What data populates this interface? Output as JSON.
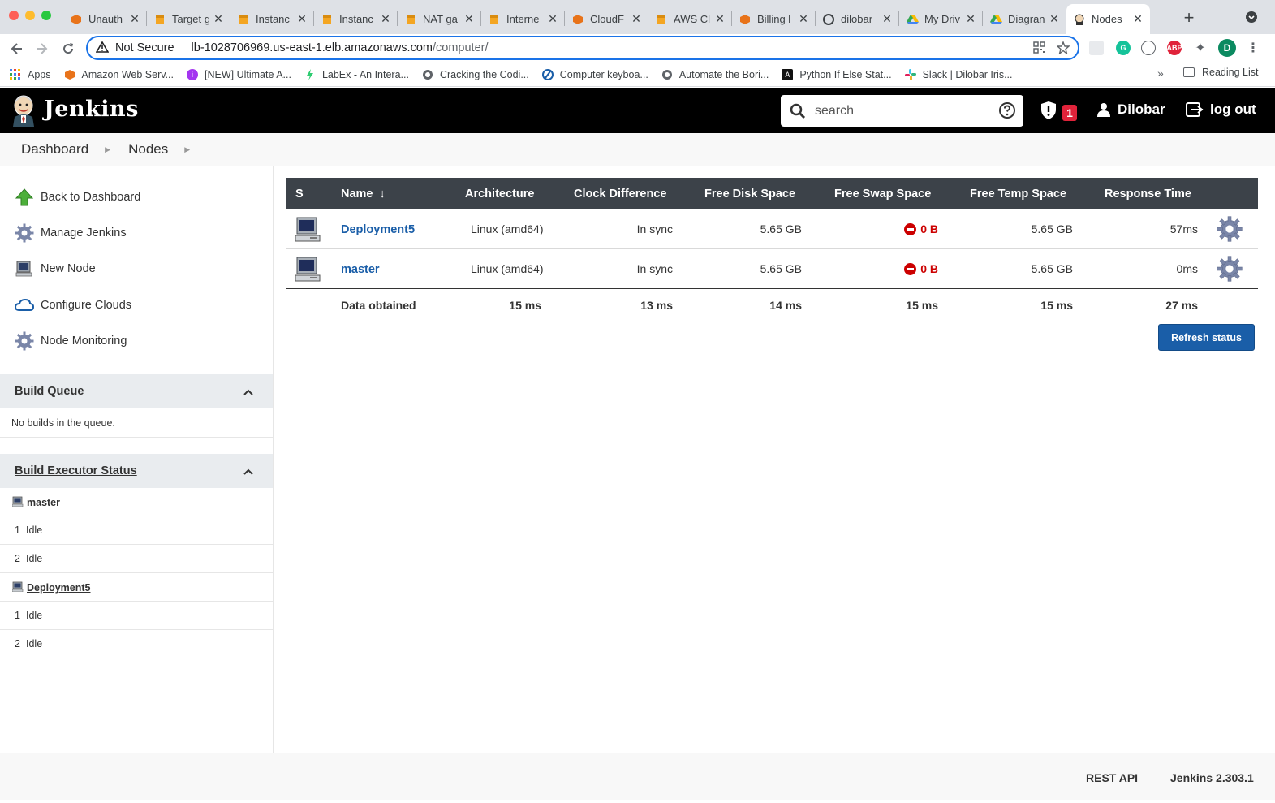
{
  "browser": {
    "tabs": [
      {
        "title": "Unauth",
        "icon": "aws-icon"
      },
      {
        "title": "Target g",
        "icon": "aws-box-icon",
        "active": true
      },
      {
        "title": "Instanc",
        "icon": "aws-box-icon"
      },
      {
        "title": "Instanc",
        "icon": "aws-box-icon"
      },
      {
        "title": "NAT ga",
        "icon": "aws-box-icon"
      },
      {
        "title": "Interne",
        "icon": "aws-box-icon"
      },
      {
        "title": "CloudF",
        "icon": "aws-icon"
      },
      {
        "title": "AWS Cl",
        "icon": "aws-box-icon"
      },
      {
        "title": "Billing l",
        "icon": "aws-icon"
      },
      {
        "title": "dilobar",
        "icon": "github-icon"
      },
      {
        "title": "My Driv",
        "icon": "drive-icon"
      },
      {
        "title": "Diagran",
        "icon": "drive-icon"
      },
      {
        "title": "Nodes",
        "icon": "jenkins-icon",
        "current": true
      }
    ],
    "url": {
      "security": "Not Secure",
      "host": "lb-1028706969.us-east-1.elb.amazonaws.com",
      "path": "/computer/"
    },
    "profile_initial": "D",
    "bookmarks": [
      {
        "label": "Apps",
        "icon": "apps-grid-icon"
      },
      {
        "label": "Amazon Web Serv...",
        "icon": "aws-icon"
      },
      {
        "label": "[NEW] Ultimate A...",
        "icon": "udemy-icon"
      },
      {
        "label": "LabEx - An Intera...",
        "icon": "labex-icon"
      },
      {
        "label": "Cracking the Codi...",
        "icon": "globe-icon"
      },
      {
        "label": "Computer keyboa...",
        "icon": "blue-circle-icon"
      },
      {
        "label": "Automate the Bori...",
        "icon": "globe-icon"
      },
      {
        "label": "Python If Else Stat...",
        "icon": "dark-icon"
      },
      {
        "label": "Slack | Dilobar Iris...",
        "icon": "slack-icon"
      }
    ],
    "more_bookmarks": "»",
    "reading_list": "Reading List"
  },
  "header": {
    "title": "Jenkins",
    "search_placeholder": "search",
    "security_count": "1",
    "user": "Dilobar",
    "logout": "log out"
  },
  "breadcrumb": [
    "Dashboard",
    "Nodes"
  ],
  "side": {
    "tasks": [
      {
        "label": "Back to Dashboard",
        "icon": "up-arrow-icon"
      },
      {
        "label": "Manage Jenkins",
        "icon": "gear-icon"
      },
      {
        "label": "New Node",
        "icon": "computer-icon"
      },
      {
        "label": "Configure Clouds",
        "icon": "cloud-icon"
      },
      {
        "label": "Node Monitoring",
        "icon": "gear-icon"
      }
    ],
    "build_queue": {
      "title": "Build Queue",
      "empty": "No builds in the queue."
    },
    "executors": {
      "title": "Build Executor Status",
      "computers": [
        {
          "name": "master",
          "slots": [
            {
              "n": "1",
              "state": "Idle"
            },
            {
              "n": "2",
              "state": "Idle"
            }
          ]
        },
        {
          "name": "Deployment5",
          "slots": [
            {
              "n": "1",
              "state": "Idle"
            },
            {
              "n": "2",
              "state": "Idle"
            }
          ]
        }
      ]
    }
  },
  "table": {
    "headers": {
      "s": "S",
      "name": "Name",
      "sort": "↓",
      "arch": "Architecture",
      "clock": "Clock Difference",
      "disk": "Free Disk Space",
      "swap": "Free Swap Space",
      "temp": "Free Temp Space",
      "resp": "Response Time"
    },
    "rows": [
      {
        "name": "Deployment5",
        "arch": "Linux (amd64)",
        "clock": "In sync",
        "disk": "5.65 GB",
        "swap": "0 B",
        "temp": "5.65 GB",
        "resp": "57ms"
      },
      {
        "name": "master",
        "arch": "Linux (amd64)",
        "clock": "In sync",
        "disk": "5.65 GB",
        "swap": "0 B",
        "temp": "5.65 GB",
        "resp": "0ms"
      }
    ],
    "footer": {
      "label": "Data obtained",
      "arch": "15 ms",
      "clock": "13 ms",
      "disk": "14 ms",
      "swap": "15 ms",
      "temp": "15 ms",
      "resp": "27 ms"
    },
    "refresh": "Refresh status"
  },
  "footer": {
    "rest_api": "REST API",
    "version": "Jenkins 2.303.1"
  },
  "colors": {
    "jenkins_header": "#000000",
    "link_blue": "#1a5ea8",
    "error_red": "#cc0000",
    "table_header": "#3c4249"
  }
}
